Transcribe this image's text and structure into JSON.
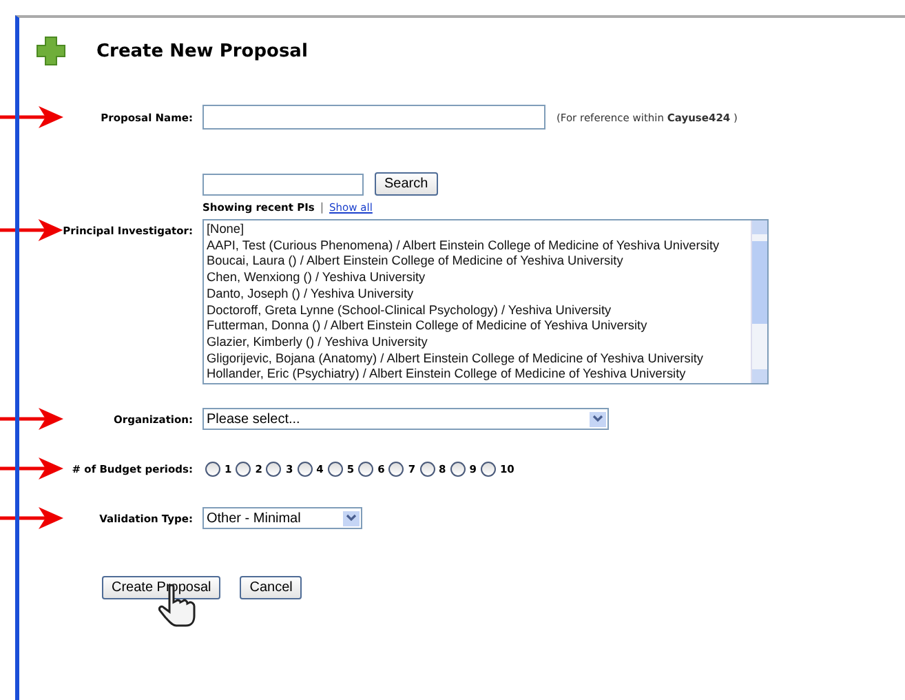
{
  "title": "Create New Proposal",
  "proposal_name": {
    "label": "Proposal Name:",
    "hint_prefix": "(For reference within ",
    "hint_bold": "Cayuse424",
    "hint_suffix": " )"
  },
  "pi_search": {
    "button": "Search",
    "showing": "Showing recent PIs",
    "separator": "|",
    "link": "Show all"
  },
  "principal_investigator": {
    "label": "Principal Investigator:",
    "options": [
      {
        "text": "[None]",
        "selected": false
      },
      {
        "text": "AAPI, Test (Curious Phenomena) / Albert Einstein College of Medicine of Yeshiva University",
        "selected": false
      },
      {
        "text": "Boucai, Laura () / Albert Einstein College of Medicine of Yeshiva University",
        "selected": false
      },
      {
        "text": "Chen, Wenxiong () / Yeshiva University",
        "selected": false
      },
      {
        "text": "Danto, Joseph () / Yeshiva University",
        "selected": false
      },
      {
        "text": "Doctoroff, Greta Lynne (School-Clinical Psychology) / Yeshiva University",
        "selected": false
      },
      {
        "text": "Futterman, Donna () / Albert Einstein College of Medicine of Yeshiva University",
        "selected": false
      },
      {
        "text": "Glazier, Kimberly () / Yeshiva University",
        "selected": false
      },
      {
        "text": "Gligorijevic, Bojana (Anatomy) / Albert Einstein College of Medicine of Yeshiva University",
        "selected": false
      },
      {
        "text": "Hollander, Eric (Psychiatry) / Albert Einstein College of Medicine of Yeshiva University",
        "selected": false
      }
    ]
  },
  "organization": {
    "label": "Organization:",
    "value": "Please select..."
  },
  "budget_periods": {
    "label": "# of Budget periods:",
    "options": [
      {
        "label": "1",
        "selected": false
      },
      {
        "label": "2",
        "selected": false
      },
      {
        "label": "3",
        "selected": false
      },
      {
        "label": "4",
        "selected": false
      },
      {
        "label": "5",
        "selected": false
      },
      {
        "label": "6",
        "selected": false
      },
      {
        "label": "7",
        "selected": false
      },
      {
        "label": "8",
        "selected": false
      },
      {
        "label": "9",
        "selected": false
      },
      {
        "label": "10",
        "selected": false
      }
    ]
  },
  "validation_type": {
    "label": "Validation Type:",
    "value": "Other - Minimal"
  },
  "buttons": [
    "Create Proposal",
    "Cancel"
  ]
}
